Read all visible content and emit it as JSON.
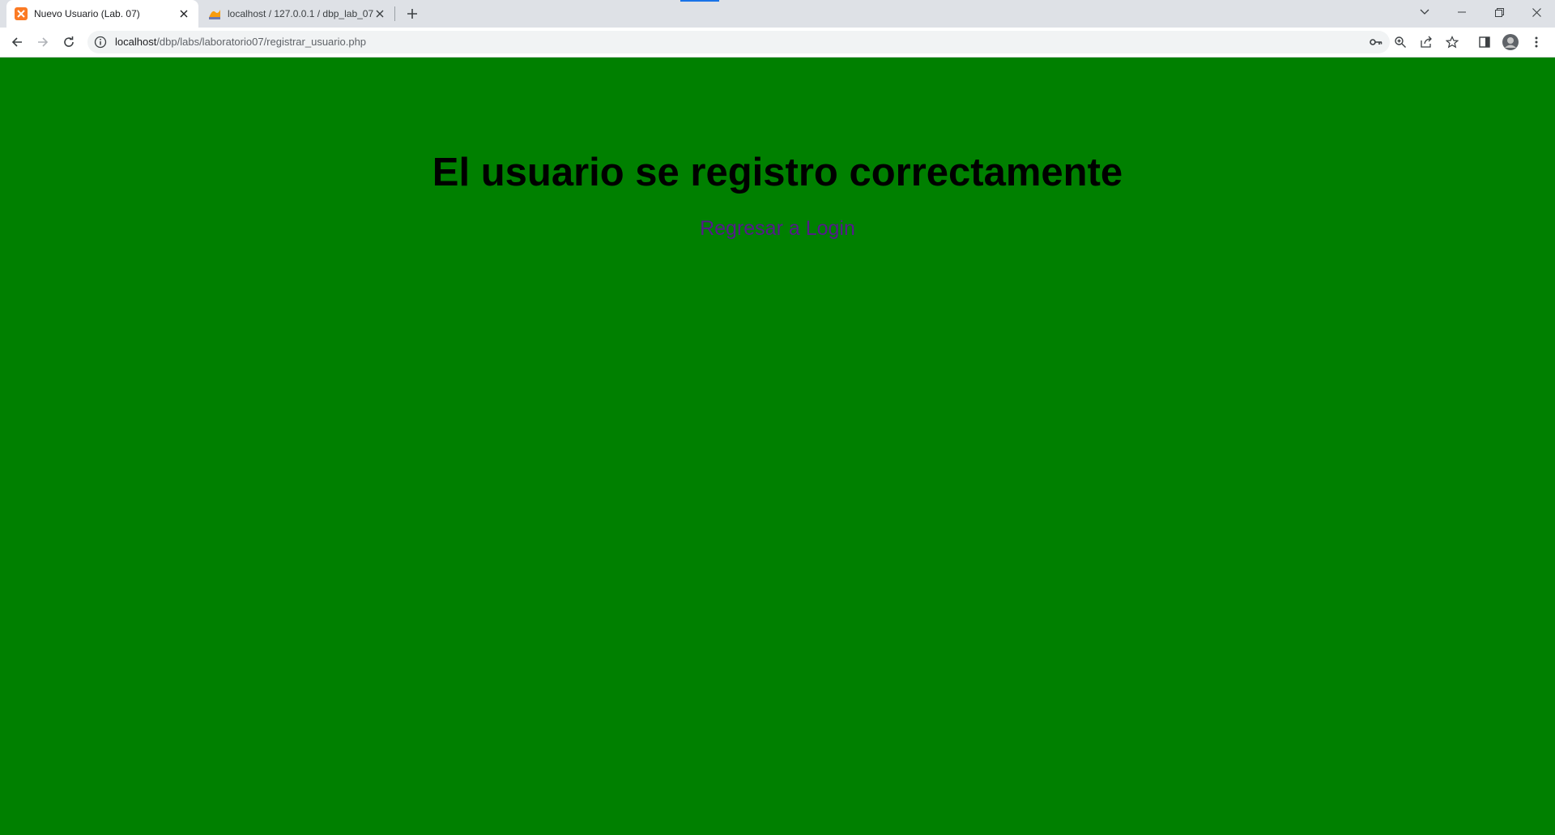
{
  "browser": {
    "tabs": [
      {
        "title": "Nuevo Usuario (Lab. 07)",
        "active": true,
        "favicon": "xampp-icon"
      },
      {
        "title": "localhost / 127.0.0.1 / dbp_lab_07",
        "active": false,
        "favicon": "phpmyadmin-icon"
      }
    ],
    "url_host": "localhost",
    "url_path": "/dbp/labs/laboratorio07/registrar_usuario.php"
  },
  "page": {
    "heading": "El usuario se registro correctamente",
    "link_label": "Regresar a Login",
    "background_color": "#008000",
    "link_color": "#551a8b"
  }
}
